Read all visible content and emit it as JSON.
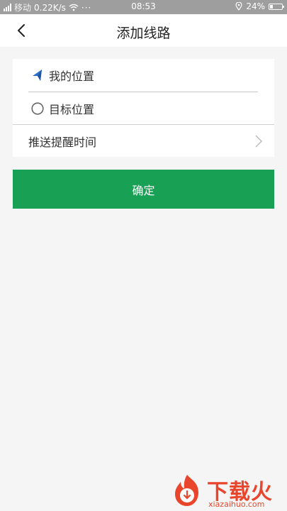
{
  "status_bar": {
    "network_speed": "0.22K/s",
    "carrier_text": "移动",
    "time": "08:53",
    "battery": "24%",
    "battery_level": 0.24
  },
  "header": {
    "title": "添加线路",
    "back_icon": "back-chevron-icon"
  },
  "form": {
    "my_location_label": "我的位置",
    "my_location_icon": "navigation-arrow-icon",
    "destination_label": "目标位置",
    "destination_icon": "radio-circle-icon",
    "push_time_label": "推送提醒时间",
    "push_time_icon": "chevron-right-icon"
  },
  "actions": {
    "confirm_label": "确定"
  },
  "watermark": {
    "brand": "下载火",
    "url": "xiazaihuo.com"
  },
  "colors": {
    "accent_green": "#18a055",
    "nav_arrow_blue": "#2a6fc9",
    "watermark_red": "#e8452c"
  }
}
